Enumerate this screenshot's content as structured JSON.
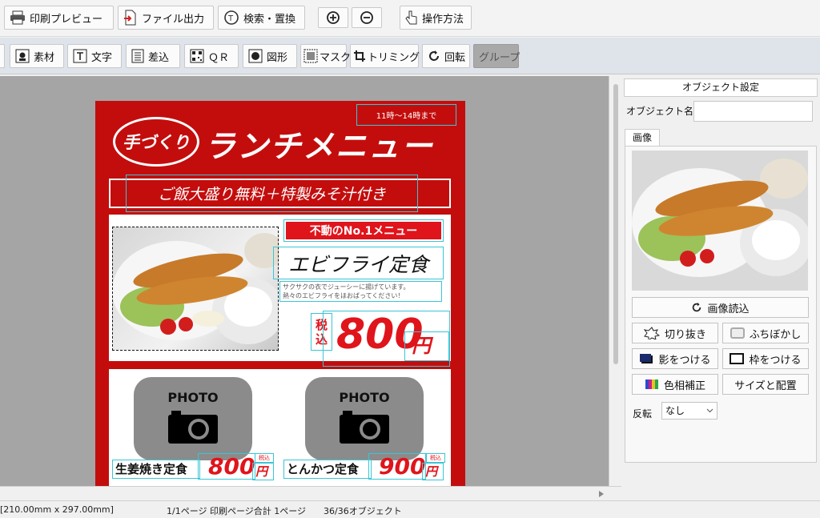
{
  "toolbar1": {
    "print_preview": "印刷プレビュー",
    "file_output": "ファイル出力",
    "search_replace": "検索・置換",
    "how_to": "操作方法"
  },
  "toolbar2": {
    "material": "素材",
    "text": "文字",
    "merge": "差込",
    "qr": "ＱＲ",
    "shape": "図形",
    "mask": "マスク",
    "trimming": "トリミング",
    "rotate": "回転",
    "group": "グループ"
  },
  "flyer": {
    "time_note": "11時〜14時まで",
    "logo_text": "手づくり",
    "title": "ランチメニュー",
    "subtitle": "ご飯大盛り無料＋特製みそ汁付き",
    "badge": "不動のNo.1メニュー",
    "main_dish": "エビフライ定食",
    "description_line1": "サクサクの衣でジューシーに揚げています。",
    "description_line2": "熱々のエビフライをほおばってください！",
    "tax_label_1": "税",
    "tax_label_2": "込",
    "main_price": "800",
    "yen": "円",
    "photo_label": "PHOTO",
    "item1_name": "生姜焼き定食",
    "item1_price": "800",
    "item2_name": "とんかつ定食",
    "item2_price": "900",
    "small_tax": "税込"
  },
  "panel": {
    "header": "オブジェクト設定",
    "object_name_label": "オブジェクト名",
    "object_name_value": "",
    "tab_image": "画像",
    "load_image": "画像読込",
    "crop": "切り抜き",
    "blur_edges": "ふちぼかし",
    "add_shadow": "影をつける",
    "add_frame": "枠をつける",
    "hue_correction": "色相補正",
    "size_position": "サイズと配置",
    "flip_label": "反転",
    "flip_value": "なし"
  },
  "statusbar": {
    "page_size": "[210.00mm x 297.00mm]",
    "page_info": "1/1ページ 印刷ページ合計 1ページ",
    "object_count": "36/36オブジェクト"
  }
}
